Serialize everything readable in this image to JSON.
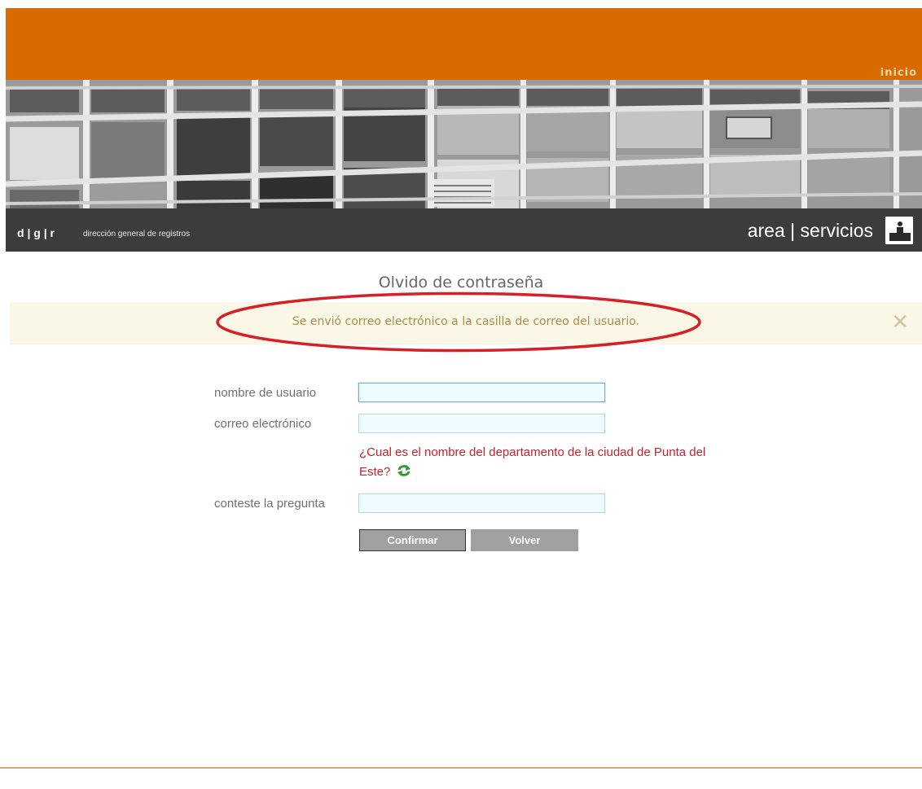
{
  "header": {
    "nav_link": "inicio",
    "brand_logo": "d | g | r",
    "brand_name": "dirección general de registros",
    "section_title": "area | servicios",
    "section_icon": "person-at-desk-icon",
    "banner_image": "building-facade-windows-photo"
  },
  "page": {
    "title": "Olvido de contraseña"
  },
  "alert": {
    "message": "Se envió correo electrónico a la casilla de correo del usuario.",
    "close_symbol": "✕",
    "highlight_color": "#d61f26"
  },
  "form": {
    "username_label": "nombre de usuario",
    "username_value": "",
    "email_label": "correo electrónico",
    "email_value": "",
    "question_text": "¿Cual es el nombre del departamento de la ciudad de Punta del Este?",
    "refresh_icon": "refresh-icon",
    "answer_label": "conteste la pregunta",
    "answer_value": "",
    "confirm_label": "Confirmar",
    "back_label": "Volver"
  },
  "colors": {
    "header_orange": "#d76b00",
    "brand_bar": "#3c3c3c",
    "alert_bg": "#fbf7e6",
    "alert_text": "#a88f4c",
    "question_red": "#c8202c",
    "button_gray": "#a0a0a0"
  }
}
